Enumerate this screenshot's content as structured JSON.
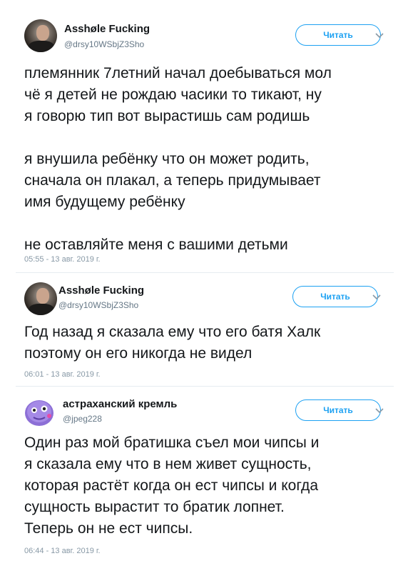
{
  "tweets": [
    {
      "name": "Asshøle Fucking",
      "handle": "@drsy10WSbjZ3Sho",
      "follow_label": "Читать",
      "lines": [
        "племянник 7летний начал доебываться мол",
        "чё я детей не рождаю часики то тикают, ну",
        "я говорю тип вот вырастишь сам родишь",
        "",
        "я внушила ребёнку что он может родить,",
        "сначала он плакал, а теперь придумывает",
        "имя будущему ребёнку",
        "",
        "не оставляйте меня с вашими детьми"
      ],
      "timestamp": "05:55 - 13 авг. 2019 г."
    },
    {
      "name": "Asshøle Fucking",
      "handle": "@drsy10WSbjZ3Sho",
      "follow_label": "Читать",
      "lines": [
        "Год назад я сказала ему что его батя Халк",
        "поэтому он его никогда не видел"
      ],
      "timestamp": "06:01 - 13 авг. 2019 г."
    },
    {
      "name": "астраханский кремль",
      "handle": "@jpeg228",
      "follow_label": "Читать",
      "lines": [
        "Один раз мой братишка съел мои чипсы и",
        "я сказала ему что в нем живет сущность,",
        "которая растёт когда он ест чипсы и когда",
        "сущность вырастит то братик лопнет.",
        "Теперь он не ест чипсы."
      ],
      "timestamp": "06:44 - 13 авг. 2019 г."
    }
  ]
}
